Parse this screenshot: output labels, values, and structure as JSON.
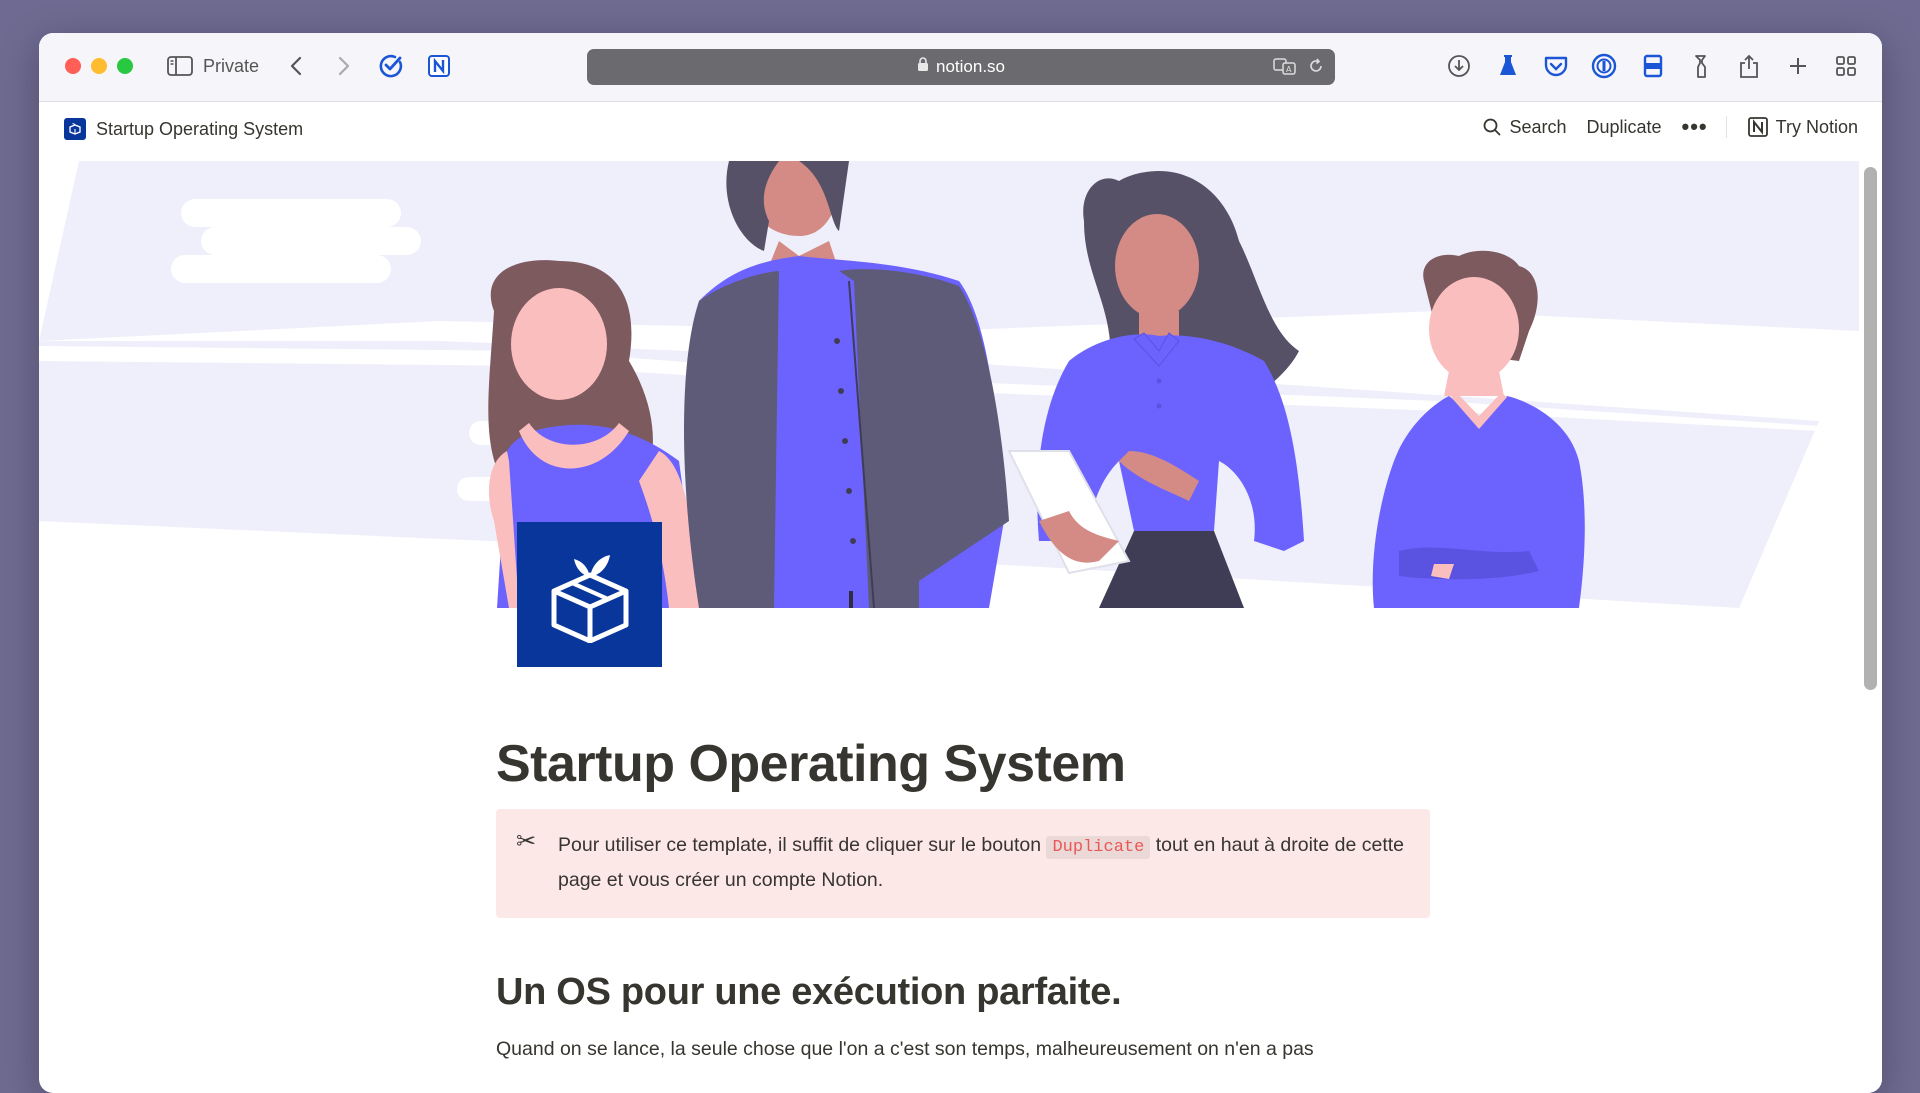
{
  "browser": {
    "private_label": "Private",
    "url": "notion.so"
  },
  "notion_bar": {
    "page_title": "Startup Operating System",
    "search_label": "Search",
    "duplicate_label": "Duplicate",
    "more_label": "•••",
    "try_notion_label": "Try Notion"
  },
  "page": {
    "title": "Startup Operating System",
    "callout": {
      "icon": "✂",
      "text_before": "Pour utiliser ce template, il suffit de cliquer sur le bouton ",
      "code": "Duplicate",
      "text_after": " tout en haut à droite de cette page et vous créer un compte Notion."
    },
    "heading": "Un OS pour une exécution parfaite.",
    "paragraph": "Quand on se lance, la seule chose que l'on a c'est son temps, malheureusement on n'en a pas"
  },
  "colors": {
    "accent": "#08369a",
    "illustration_purple": "#6c63ff",
    "callout_bg": "#fde8e8",
    "code_red": "#eb5757"
  },
  "icons": [
    "sidebar-icon",
    "back-icon",
    "forward-icon",
    "check-circle-icon",
    "notion-extension-icon",
    "lock-icon",
    "translate-icon",
    "reload-icon",
    "download-icon",
    "flask-icon",
    "pocket-icon",
    "password-icon",
    "tab-icon",
    "bottle-icon",
    "share-icon",
    "new-tab-icon",
    "tab-overview-icon",
    "search-icon",
    "notion-logo-icon"
  ]
}
